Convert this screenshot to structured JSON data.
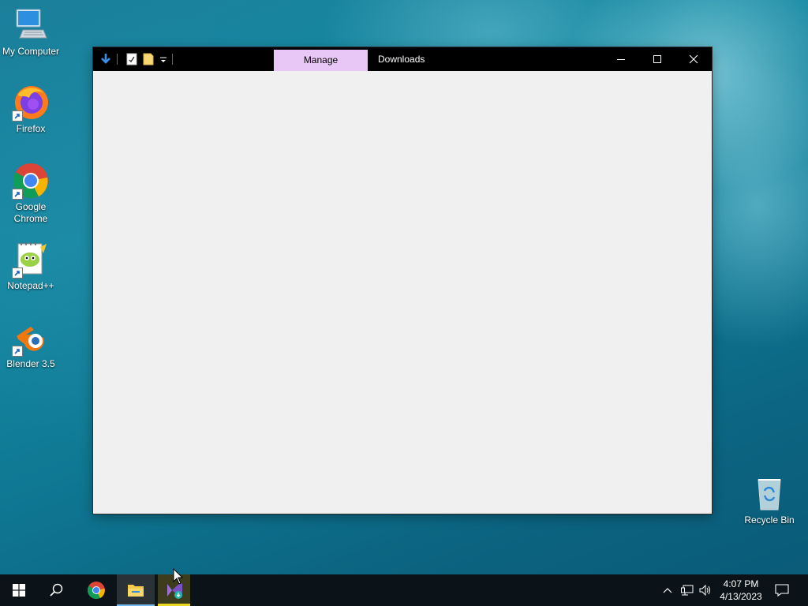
{
  "desktop": {
    "icons": [
      {
        "label": "My Computer"
      },
      {
        "label": "Firefox"
      },
      {
        "label": "Google Chrome"
      },
      {
        "label": "Notepad++"
      },
      {
        "label": "Blender 3.5"
      }
    ],
    "recycle_bin": {
      "label": "Recycle Bin"
    }
  },
  "window": {
    "title": "Downloads",
    "context_tab": "Manage",
    "quick_access": [
      "download-arrow-icon",
      "properties-icon",
      "new-folder-icon",
      "customize-dropdown-icon"
    ],
    "controls": [
      "minimize",
      "maximize",
      "close"
    ]
  },
  "taskbar": {
    "pinned": [
      "start",
      "search",
      "chrome",
      "file-explorer",
      "visual-studio-installer"
    ],
    "active": "file-explorer",
    "tray": {
      "time": "4:07 PM",
      "date": "4/13/2023"
    }
  },
  "colors": {
    "manage_tab": "#e8c6f5",
    "titlebar": "#000000",
    "taskbar": "#0c1318",
    "window_body": "#f0f0f0",
    "active_underline": "#76b9ed",
    "app_underline": "#e9d820"
  }
}
